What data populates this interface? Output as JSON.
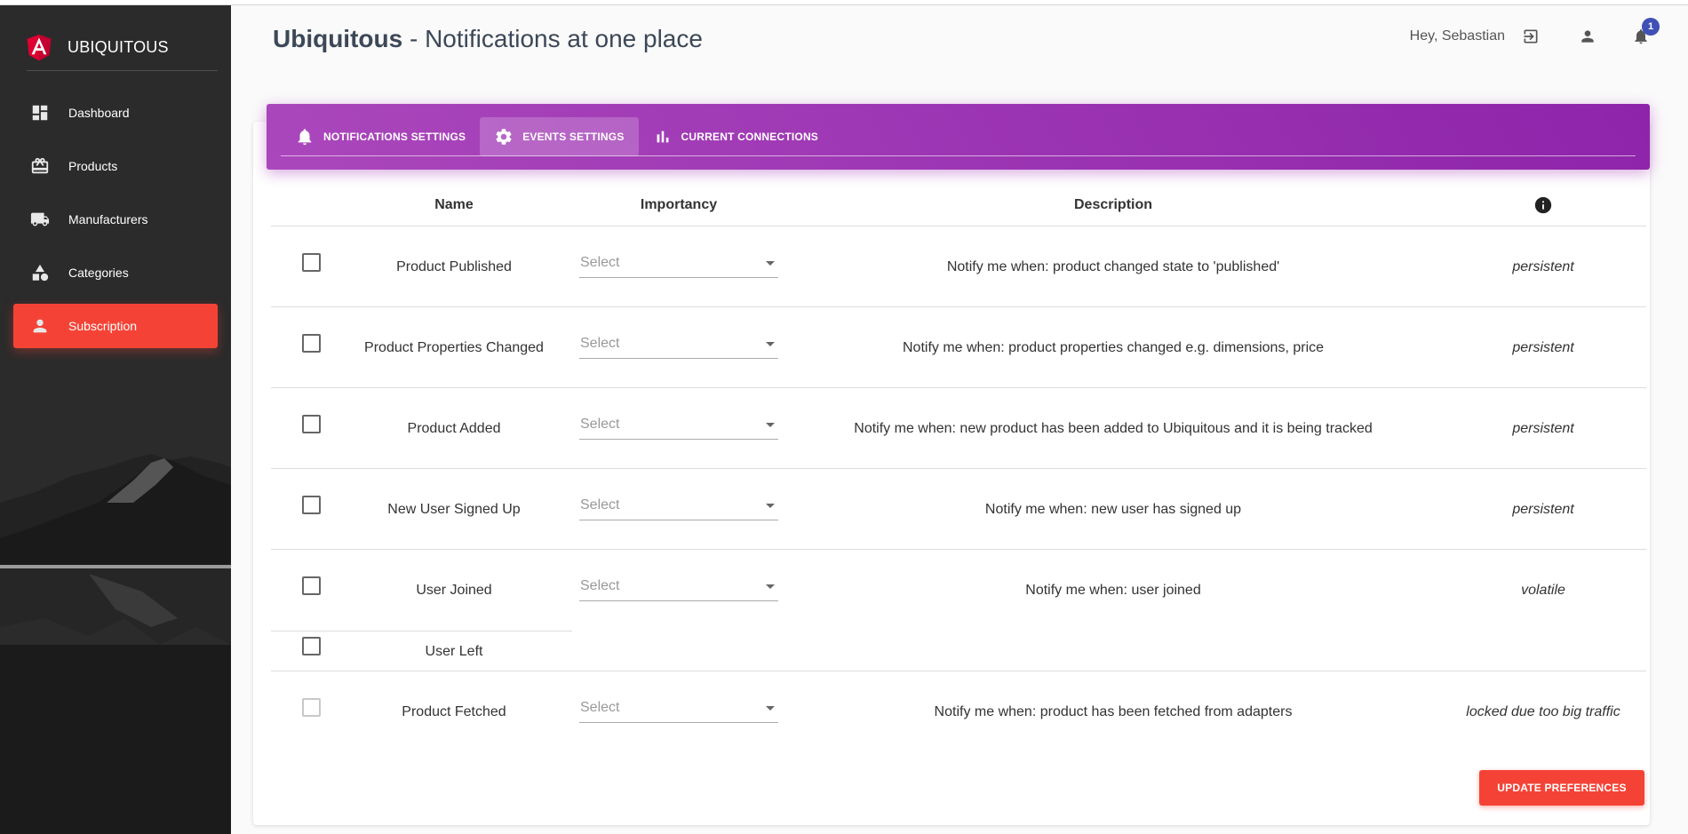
{
  "app": {
    "brand": "UBIQUITOUS",
    "title_bold": "Ubiquitous",
    "title_rest": " - Notifications at one place",
    "greeting": "Hey, Sebastian",
    "notification_count": "1"
  },
  "sidebar": {
    "items": [
      {
        "label": "Dashboard",
        "icon": "dashboard-icon",
        "active": false
      },
      {
        "label": "Products",
        "icon": "products-icon",
        "active": false
      },
      {
        "label": "Manufacturers",
        "icon": "truck-icon",
        "active": false
      },
      {
        "label": "Categories",
        "icon": "categories-icon",
        "active": false
      },
      {
        "label": "Subscription",
        "icon": "person-icon",
        "active": true
      }
    ]
  },
  "tabs": [
    {
      "label": "NOTIFICATIONS SETTINGS",
      "icon": "bell-icon",
      "active": false
    },
    {
      "label": "EVENTS SETTINGS",
      "icon": "gear-icon",
      "active": true
    },
    {
      "label": "CURRENT CONNECTIONS",
      "icon": "bar-chart-icon",
      "active": false
    }
  ],
  "table": {
    "headers": {
      "name": "Name",
      "importancy": "Importancy",
      "description": "Description"
    },
    "rows": [
      {
        "name": "Product Published",
        "select_placeholder": "Select",
        "description": "Notify me when: product changed state to 'published'",
        "type": "persistent"
      },
      {
        "name": "Product Properties Changed",
        "select_placeholder": "Select",
        "description": "Notify me when: product properties changed e.g. dimensions, price",
        "type": "persistent"
      },
      {
        "name": "Product Added",
        "select_placeholder": "Select",
        "description": "Notify me when: new product has been added to Ubiquitous and it is being tracked",
        "type": "persistent"
      },
      {
        "name": "New User Signed Up",
        "select_placeholder": "Select",
        "description": "Notify me when: new user has signed up",
        "type": "persistent"
      },
      {
        "name": "User Joined",
        "select_placeholder": "Select",
        "description": "Notify me when: user joined",
        "type": "volatile"
      },
      {
        "name": "User Left"
      },
      {
        "name": "Product Fetched",
        "select_placeholder": "Select",
        "description": "Notify me when: product has been fetched from adapters",
        "type": "locked due too big traffic"
      }
    ]
  },
  "actions": {
    "update_label": "UPDATE PREFERENCES"
  },
  "colors": {
    "accent": "#f44336",
    "header_purple": "#9c27b0",
    "badge": "#3f51b5"
  }
}
